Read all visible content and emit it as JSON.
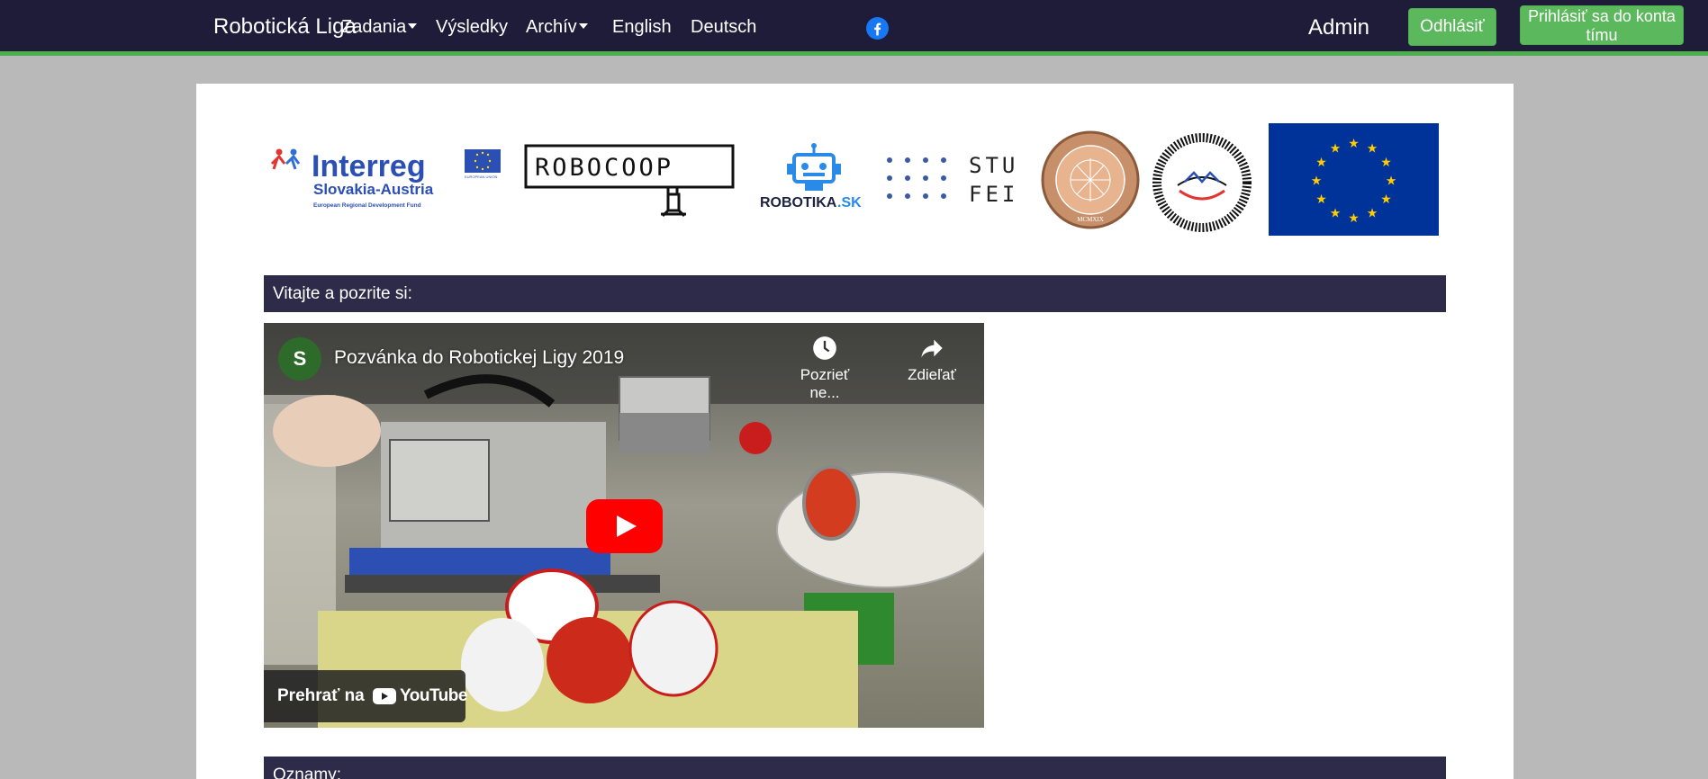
{
  "navbar": {
    "brand": "Robotická Liga",
    "items": [
      {
        "label": "Zadania",
        "dropdown": true
      },
      {
        "label": "Výsledky",
        "dropdown": false
      },
      {
        "label": "Archív",
        "dropdown": true
      },
      {
        "label": "English",
        "dropdown": false
      },
      {
        "label": "Deutsch",
        "dropdown": false
      }
    ],
    "facebook_icon": "facebook-icon",
    "admin_label": "Admin",
    "logout_label": "Odhlásiť",
    "login_label": "Prihlásiť sa do konta tímu"
  },
  "logos": {
    "interreg": {
      "name": "Interreg",
      "region": "Slovakia-Austria",
      "fund": "European Regional Development Fund",
      "eu_caption": "EUROPEAN UNION"
    },
    "robocoop": {
      "name": "ROBOCOOP"
    },
    "robotika": {
      "name": "ROBOTIKA",
      "suffix": ".SK"
    },
    "stu": {
      "line1": "STU",
      "line2": "FEI"
    },
    "uk": {
      "text": "UNIVERSITAS COMENIANA BRATISLAVENSIS",
      "year": "MCMXIX"
    },
    "cvti": {
      "text": "CENTRUM VEDECKO-TECHNICKÝCH INFORMÁCIÍ SR"
    }
  },
  "sections": {
    "welcome": "Vitajte a pozrite si:",
    "announcements": "Oznamy:"
  },
  "video": {
    "channel_initial": "S",
    "title": "Pozvánka do Robotickej Ligy 2019",
    "watch_later": "Pozrieť ne...",
    "share": "Zdieľať",
    "watch_on": "Prehrať na",
    "youtube": "YouTube"
  },
  "colors": {
    "navbar_bg": "#1f1c3a",
    "accent_green": "#5cb85c",
    "section_header_bg": "#2d2a4a",
    "page_bg": "#b9b9b9",
    "eu_blue": "#003399",
    "eu_yellow": "#ffcc00"
  }
}
